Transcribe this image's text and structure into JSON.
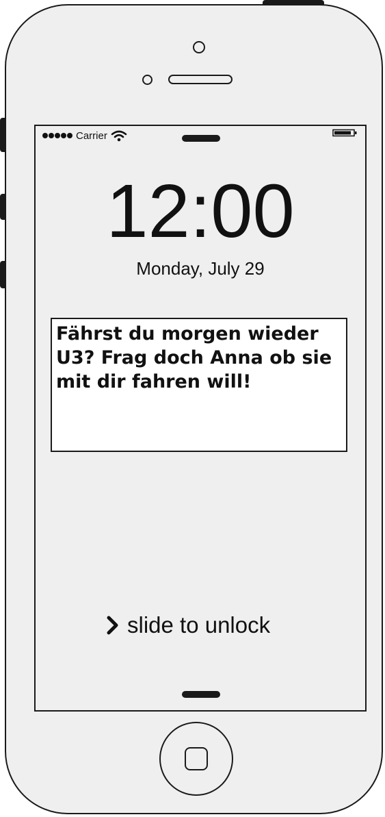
{
  "status_bar": {
    "carrier": "Carrier",
    "signal_icon": "signal-dots-icon",
    "wifi_icon": "wifi-icon",
    "battery_icon": "battery-icon"
  },
  "lock_screen": {
    "time": "12:00",
    "date": "Monday, July 29"
  },
  "notification": {
    "message": "Fährst du morgen wieder U3? Frag doch Anna ob sie mit dir fahren will!"
  },
  "unlock": {
    "label": "slide to unlock",
    "icon": "chevron-right-icon"
  },
  "colors": {
    "device_body": "#efefef",
    "outline": "#1a1a1a",
    "notification_bg": "#ffffff"
  }
}
